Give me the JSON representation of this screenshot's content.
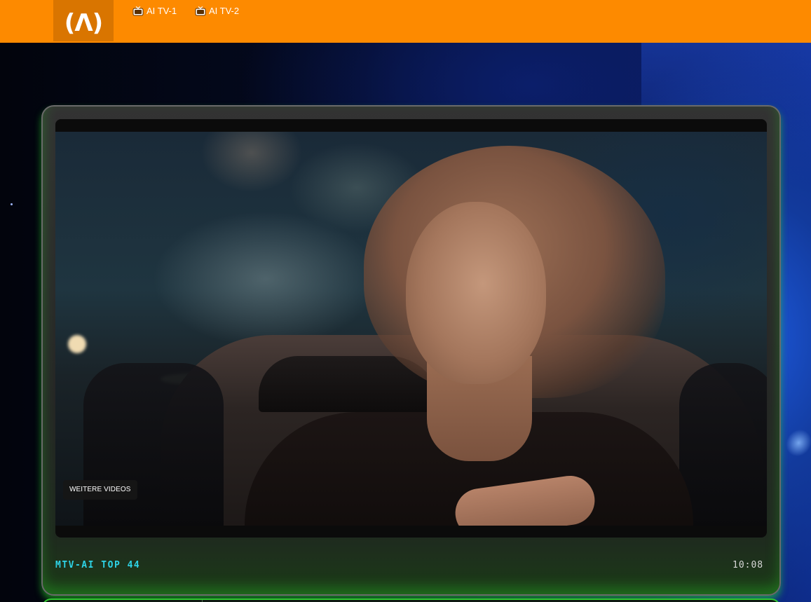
{
  "header": {
    "logo_text": "(Λ)",
    "nav": [
      {
        "label": "AI TV-1",
        "icon": "tv-icon"
      },
      {
        "label": "AI TV-2",
        "icon": "tv-icon"
      }
    ],
    "accent_color": "#fd8a00"
  },
  "player": {
    "more_videos_label": "WEITERE VIDEOS",
    "show_title": "MTV-AI TOP 44",
    "clock": "10:08",
    "title_color": "#2ed3e6",
    "frame_glow_color": "#32c832"
  }
}
